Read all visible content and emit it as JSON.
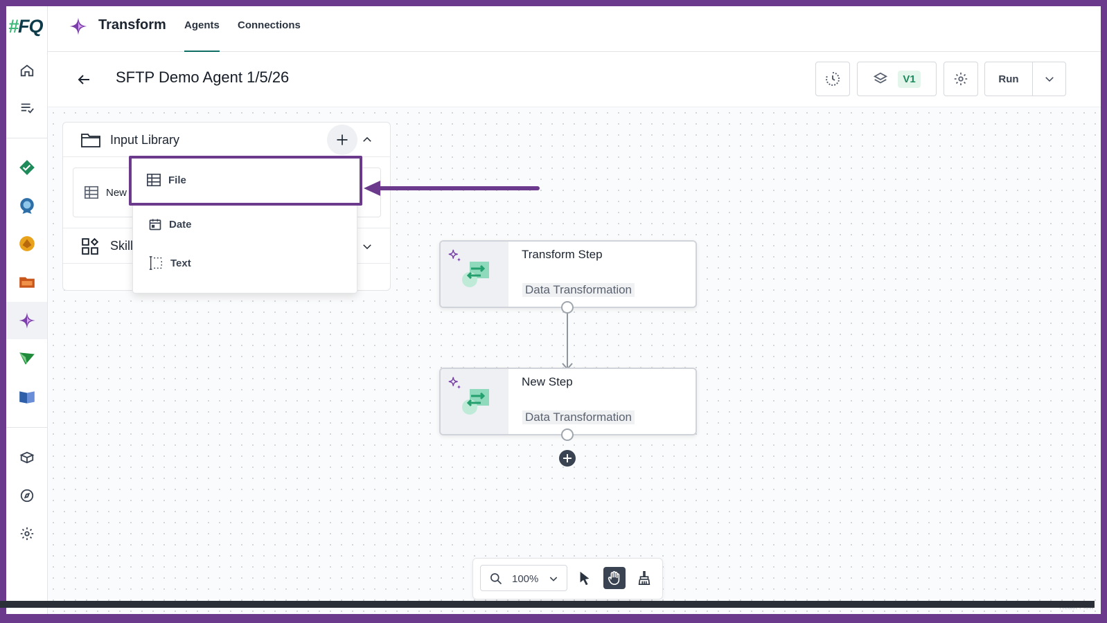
{
  "brand": {
    "hash": "#",
    "name": "FQ"
  },
  "app": {
    "title": "Transform"
  },
  "tabs": [
    {
      "label": "Agents",
      "active": true
    },
    {
      "label": "Connections",
      "active": false
    }
  ],
  "header": {
    "agent_title": "SFTP Demo Agent 1/5/26",
    "version_badge": "V1",
    "run_label": "Run"
  },
  "rail": {
    "icons": [
      "home-icon",
      "task-list-icon",
      "checklist-app-icon",
      "shield-badge-app-icon",
      "exchange-app-icon",
      "folder-app-icon",
      "transform-sparkle-icon",
      "send-app-icon",
      "book-app-icon",
      "package-icon",
      "compass-icon",
      "gear-icon"
    ],
    "active": "transform-sparkle-icon"
  },
  "input_library": {
    "title": "Input Library",
    "new_row_label": "New",
    "skills_label": "Skill"
  },
  "dropdown": {
    "items": [
      {
        "label": "File",
        "icon": "table-icon"
      },
      {
        "label": "Date",
        "icon": "calendar-icon"
      },
      {
        "label": "Text",
        "icon": "text-cursor-icon"
      }
    ]
  },
  "nodes": [
    {
      "title": "Transform Step",
      "subtitle": "Data Transformation"
    },
    {
      "title": "New Step",
      "subtitle": "Data Transformation"
    }
  ],
  "toolbar": {
    "zoom": "100%"
  },
  "colors": {
    "accent": "#6b3a8c",
    "brand_green": "#3fb97a",
    "tab_underline": "#0e6e64",
    "node_icon": "#3fbf8f"
  }
}
